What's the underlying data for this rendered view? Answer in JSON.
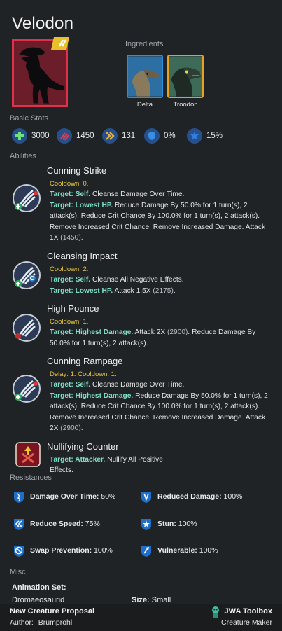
{
  "creature": {
    "name": "Velodon"
  },
  "ingredients": {
    "label": "Ingredients",
    "items": [
      {
        "name": "Delta",
        "frame_color": "#2a8ee0"
      },
      {
        "name": "Troodon",
        "frame_color": "#e8a020"
      }
    ]
  },
  "basic_stats": {
    "label": "Basic Stats",
    "items": [
      {
        "icon": "health-icon",
        "value": "3000"
      },
      {
        "icon": "damage-icon",
        "value": "1450"
      },
      {
        "icon": "speed-icon",
        "value": "131"
      },
      {
        "icon": "armor-icon",
        "value": "0%"
      },
      {
        "icon": "crit-icon",
        "value": "15%"
      }
    ]
  },
  "abilities": {
    "label": "Abilities",
    "items": [
      {
        "name": "Cunning Strike",
        "icon": "claw-strike-icon",
        "lines": [
          {
            "t": "cd",
            "text": "Cooldown: 0."
          },
          {
            "t": "seg",
            "segs": [
              [
                "tg",
                "Target: Self."
              ],
              [
                "",
                " Cleanse Damage Over Time."
              ]
            ]
          },
          {
            "t": "seg",
            "segs": [
              [
                "tg",
                "Target: Lowest HP."
              ],
              [
                "",
                " Reduce Damage By 50.0% for 1 turn(s), 2"
              ]
            ]
          },
          {
            "t": "seg",
            "segs": [
              [
                "",
                "attack(s). Reduce Crit Chance By 100.0% for 1 turn(s), 2 attack(s)."
              ]
            ]
          },
          {
            "t": "seg",
            "segs": [
              [
                "",
                "Remove Increased Crit Chance. Remove Increased Damage. Attack"
              ]
            ]
          },
          {
            "t": "seg",
            "segs": [
              [
                "",
                "1X "
              ],
              [
                "num",
                "(1450)"
              ],
              [
                "",
                "."
              ]
            ]
          }
        ]
      },
      {
        "name": "Cleansing Impact",
        "icon": "cleanse-claw-icon",
        "lines": [
          {
            "t": "cd",
            "text": "Cooldown: 2."
          },
          {
            "t": "seg",
            "segs": [
              [
                "tg",
                "Target: Self."
              ],
              [
                "",
                " Cleanse All Negative Effects."
              ]
            ]
          },
          {
            "t": "seg",
            "segs": [
              [
                "tg",
                "Target: Lowest HP."
              ],
              [
                "",
                " Attack 1.5X "
              ],
              [
                "num",
                "(2175)"
              ],
              [
                "",
                "."
              ]
            ]
          }
        ]
      },
      {
        "name": "High Pounce",
        "icon": "pounce-claw-icon",
        "lines": [
          {
            "t": "cd",
            "text": "Cooldown: 1."
          },
          {
            "t": "seg",
            "segs": [
              [
                "tg",
                "Target: Highest Damage."
              ],
              [
                "",
                " Attack 2X "
              ],
              [
                "num",
                "(2900)"
              ],
              [
                "",
                ". Reduce Damage By"
              ]
            ]
          },
          {
            "t": "seg",
            "segs": [
              [
                "",
                "50.0% for 1 turn(s), 2 attack(s)."
              ]
            ]
          }
        ]
      },
      {
        "name": "Cunning Rampage",
        "icon": "rampage-claw-icon",
        "lines": [
          {
            "t": "cd",
            "text": "Delay: 1. Cooldown: 1."
          },
          {
            "t": "seg",
            "segs": [
              [
                "tg",
                "Target: Self."
              ],
              [
                "",
                " Cleanse Damage Over Time."
              ]
            ]
          },
          {
            "t": "seg",
            "segs": [
              [
                "tg",
                "Target: Highest Damage."
              ],
              [
                "",
                " Reduce Damage By 50.0% for 1 turn(s), 2"
              ]
            ]
          },
          {
            "t": "seg",
            "segs": [
              [
                "",
                "attack(s). Reduce Crit Chance By 100.0% for 1 turn(s), 2 attack(s)."
              ]
            ]
          },
          {
            "t": "seg",
            "segs": [
              [
                "",
                "Remove Increased Crit Chance. Remove Increased Damage. Attack"
              ]
            ]
          },
          {
            "t": "seg",
            "segs": [
              [
                "",
                "2X "
              ],
              [
                "num",
                "(2900)"
              ],
              [
                "",
                "."
              ]
            ]
          }
        ]
      },
      {
        "name": "Nullifying Counter",
        "icon": "counter-icon",
        "lines": [
          {
            "t": "seg",
            "segs": [
              [
                "tg",
                "Target: Attacker."
              ],
              [
                "",
                " Nullify All Positive"
              ]
            ]
          },
          {
            "t": "seg",
            "segs": [
              [
                "",
                "Effects."
              ]
            ]
          }
        ]
      }
    ]
  },
  "resistances": {
    "label": "Resistances",
    "items": [
      {
        "icon": "dot-resist-icon",
        "name": "Damage Over Time:",
        "value": "50%"
      },
      {
        "icon": "reduced-damage-resist-icon",
        "name": "Reduced Damage:",
        "value": "100%"
      },
      {
        "icon": "reduce-speed-resist-icon",
        "name": "Reduce Speed:",
        "value": "75%"
      },
      {
        "icon": "stun-resist-icon",
        "name": "Stun:",
        "value": "100%"
      },
      {
        "icon": "swap-prevention-resist-icon",
        "name": "Swap Prevention:",
        "value": "100%"
      },
      {
        "icon": "vulnerable-resist-icon",
        "name": "Vulnerable:",
        "value": "100%"
      }
    ]
  },
  "misc": {
    "label": "Misc",
    "animation_set_label": "Animation Set:",
    "animation_set_value": "Dromaeosaurid",
    "size_label": "Size:",
    "size_value": "Small"
  },
  "footer": {
    "proposal": "New Creature Proposal",
    "author_label": "Author:",
    "author": "Brumprohl",
    "app_name": "JWA Toolbox",
    "app_sub": "Creature Maker"
  },
  "colors": {
    "background": "#202326",
    "rarity_frame": "#e0314a",
    "cooldown": "#e4c542",
    "target": "#7fe0c8"
  }
}
